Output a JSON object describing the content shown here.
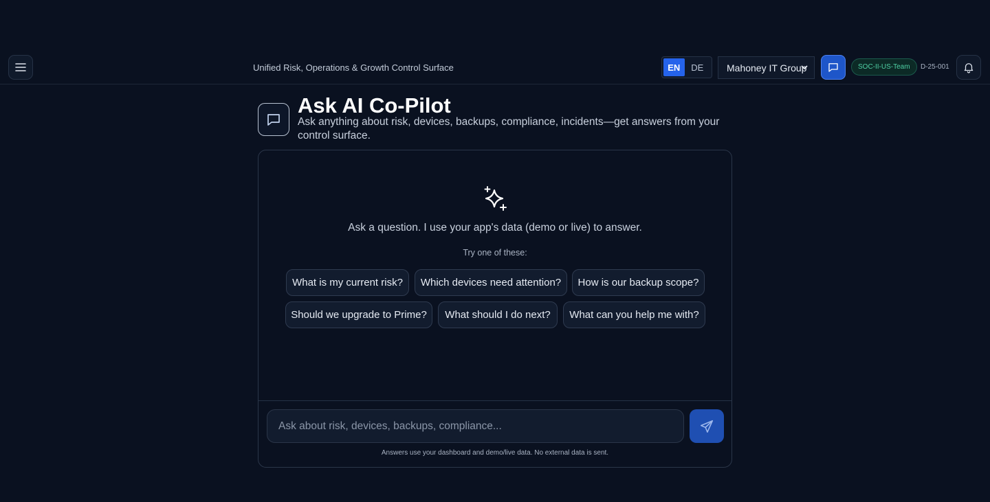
{
  "header": {
    "subtitle": "Unified Risk, Operations & Growth Control Surface",
    "lang_en": "EN",
    "lang_de": "DE",
    "org": "Mahoney IT Group",
    "team_badge": "SOC-II-US-Team",
    "device_id": "D-25-001"
  },
  "page": {
    "title": "Ask AI Co-Pilot",
    "description": "Ask anything about risk, devices, backups, compliance, incidents—get answers from your control surface."
  },
  "chat": {
    "intro": "Ask a question. I use your app's data (demo or live) to answer.",
    "try_label": "Try one of these:",
    "suggestions": [
      "What is my current risk?",
      "Which devices need attention?",
      "How is our backup scope?",
      "Should we upgrade to Prime?",
      "What should I do next?",
      "What can you help me with?"
    ],
    "input_placeholder": "Ask about risk, devices, backups, compliance...",
    "footer_note": "Answers use your dashboard and demo/live data. No external data is sent."
  },
  "colors": {
    "background": "#0a1120",
    "accent": "#2563eb",
    "badge_green": "#4fd1a5"
  },
  "icons": [
    "menu-icon",
    "chevron-down-icon",
    "chat-icon",
    "bell-icon",
    "sparkle-icon",
    "send-icon"
  ]
}
